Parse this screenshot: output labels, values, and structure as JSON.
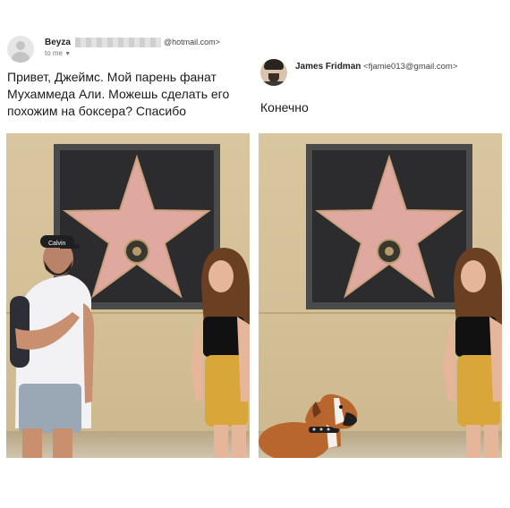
{
  "left_email": {
    "sender_name": "Beyza",
    "sender_email_domain": "@hotmail.com>",
    "recipient_label": "to me",
    "message": "Привет, Джеймс. Мой парень фанат Мухаммеда Али. Можешь сделать его похожим на боксера? Спасибо"
  },
  "right_email": {
    "sender_name": "James Fridman",
    "sender_email": "<fjamie013@gmail.com>",
    "message": "Конечно"
  },
  "photos": {
    "left": {
      "cap_text": "Calvin"
    },
    "right": {}
  },
  "colors": {
    "wall": "#d4c097",
    "plaque_frame": "#4a4a4a",
    "star_pink": "#e0a9a0",
    "tshirt": "#f2f2f4",
    "shorts_girl": "#d9a63a",
    "dog_fur": "#b8662e"
  },
  "icons": [
    "default-avatar-icon",
    "profile-avatar-icon",
    "chevron-down-icon",
    "star-plaque-emblem-icon"
  ]
}
